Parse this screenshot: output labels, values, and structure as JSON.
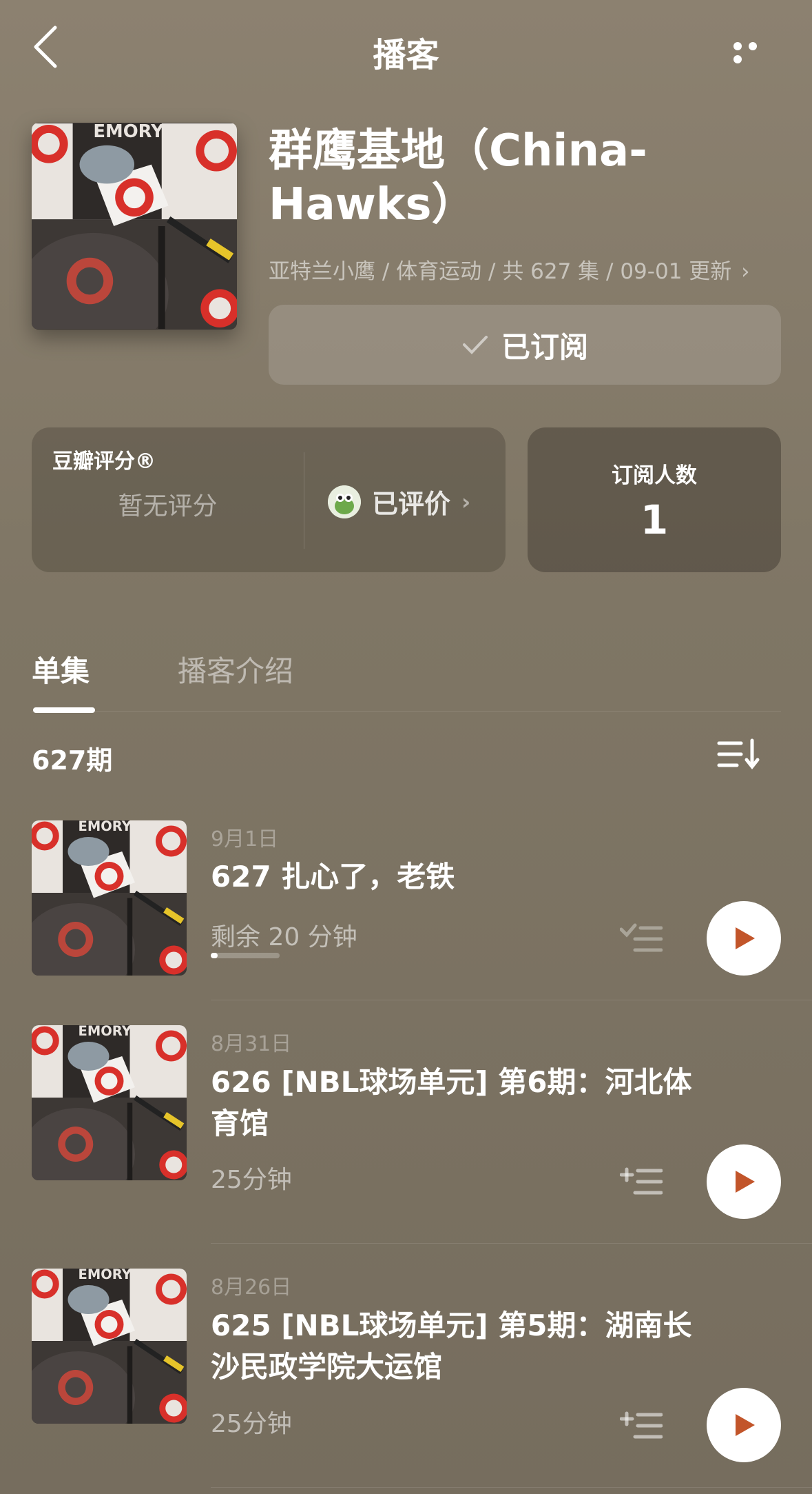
{
  "header": {
    "title": "播客"
  },
  "podcast": {
    "title": "群鹰基地（China-Hawks）",
    "meta": "亚特兰小鹰 / 体育运动 / 共 627 集 / 09-01 更新",
    "subscribe_label": "已订阅"
  },
  "rating": {
    "title": "豆瓣评分®",
    "no_rating": "暂无评分",
    "rated_label": "已评价"
  },
  "subscribers": {
    "label": "订阅人数",
    "count": "1"
  },
  "tabs": [
    {
      "label": "单集",
      "active": true
    },
    {
      "label": "播客介绍",
      "active": false
    }
  ],
  "episode_count": "627期",
  "episodes": [
    {
      "date": "9月1日",
      "title": "627 扎心了，老铁",
      "sub": "剩余 20 分钟",
      "progress": 0.1,
      "queued": true
    },
    {
      "date": "8月31日",
      "title": "626 [NBL球场单元] 第6期：河北体育馆",
      "sub": "25分钟",
      "queued": false
    },
    {
      "date": "8月26日",
      "title": "625 [NBL球场单元] 第5期：湖南长沙民政学院大运馆",
      "sub": "25分钟",
      "queued": false
    }
  ],
  "colors": {
    "background": "#857b6a",
    "accent_play": "#c2552a"
  }
}
